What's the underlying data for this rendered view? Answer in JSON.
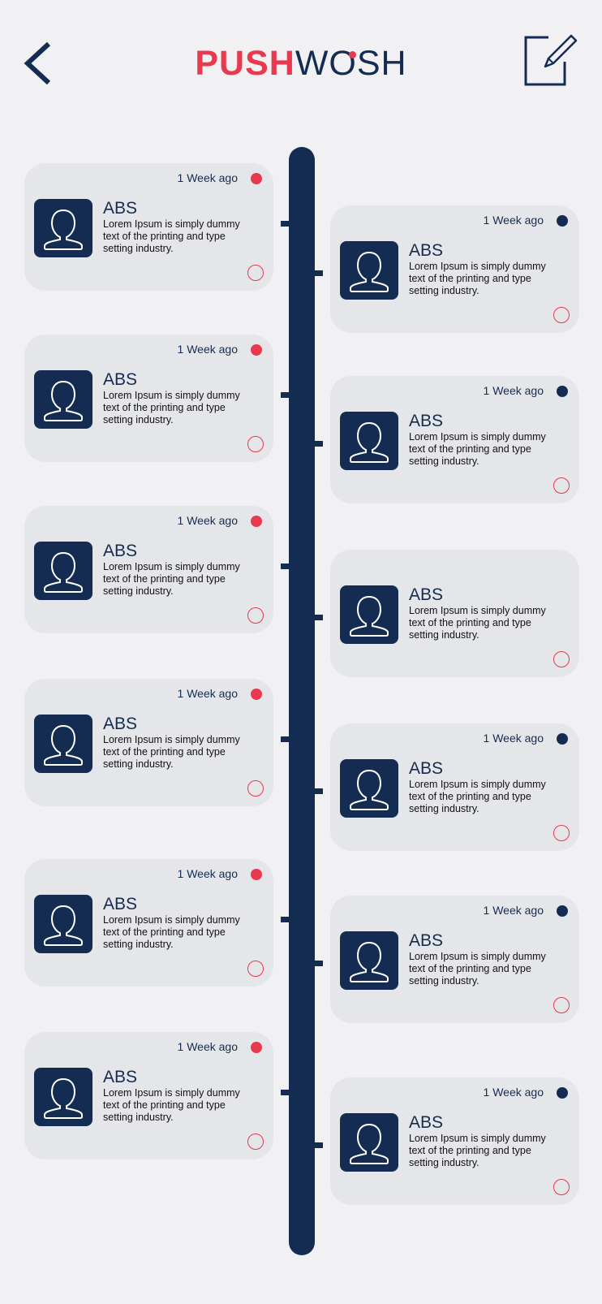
{
  "header": {
    "logo_part1": "PUSH",
    "logo_part2": "WOSH",
    "back_icon": "chevron-left-icon",
    "edit_icon": "edit-square-icon"
  },
  "colors": {
    "navy": "#152c52",
    "accent": "#e8394f",
    "background": "#f1f1f4",
    "card": "#e5e6e9"
  },
  "notifications": [
    {
      "time": "1 Week ago",
      "name": "ABS",
      "text": "Lorem Ipsum is simply dummy text of the printing and type setting industry.",
      "status_color": "#e8394f"
    },
    {
      "time": "1 Week ago",
      "name": "ABS",
      "text": "Lorem Ipsum is simply dummy text of the printing and type setting industry.",
      "status_color": "#152c52"
    },
    {
      "time": "1 Week ago",
      "name": "ABS",
      "text": "Lorem Ipsum is simply dummy text of the printing and type setting industry.",
      "status_color": "#e8394f"
    },
    {
      "time": "1 Week ago",
      "name": "ABS",
      "text": "Lorem Ipsum is simply dummy text of the printing and type setting industry.",
      "status_color": "#152c52"
    },
    {
      "time": "1 Week ago",
      "name": "ABS",
      "text": "Lorem Ipsum is simply dummy text of the printing and type setting industry.",
      "status_color": "#e8394f"
    },
    {
      "time": "",
      "name": "ABS",
      "text": "Lorem Ipsum is simply dummy text of the printing and type setting industry.",
      "status_color": ""
    },
    {
      "time": "1 Week ago",
      "name": "ABS",
      "text": "Lorem Ipsum is simply dummy text of the printing and type setting industry.",
      "status_color": "#e8394f"
    },
    {
      "time": "1 Week ago",
      "name": "ABS",
      "text": "Lorem Ipsum is simply dummy text of the printing and type setting industry.",
      "status_color": "#152c52"
    },
    {
      "time": "1 Week ago",
      "name": "ABS",
      "text": "Lorem Ipsum is simply dummy text of the printing and type setting industry.",
      "status_color": "#e8394f"
    },
    {
      "time": "1 Week ago",
      "name": "ABS",
      "text": "Lorem Ipsum is simply dummy text of the printing and type setting industry.",
      "status_color": "#152c52"
    },
    {
      "time": "1 Week ago",
      "name": "ABS",
      "text": "Lorem Ipsum is simply dummy text of the printing and type setting industry.",
      "status_color": "#e8394f"
    },
    {
      "time": "1 Week ago",
      "name": "ABS",
      "text": "Lorem Ipsum is simply dummy text of the printing and type setting industry.",
      "status_color": "#152c52"
    }
  ]
}
